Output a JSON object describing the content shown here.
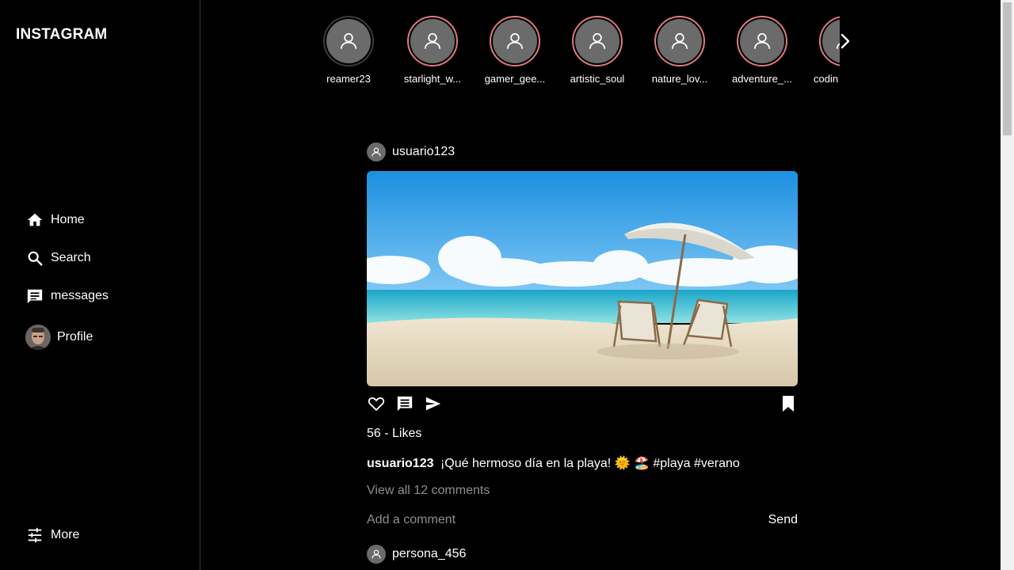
{
  "app": {
    "logo": "INSTAGRAM"
  },
  "sidebar": {
    "items": [
      {
        "label": "Home",
        "icon": "home-icon"
      },
      {
        "label": "Search",
        "icon": "search-icon"
      },
      {
        "label": "messages",
        "icon": "message-icon"
      },
      {
        "label": "Profile",
        "icon": "avatar"
      }
    ],
    "more_label": "More"
  },
  "stories": [
    {
      "name": "reamer23",
      "seen": true
    },
    {
      "name": "starlight_w...",
      "seen": false
    },
    {
      "name": "gamer_gee...",
      "seen": false
    },
    {
      "name": "artistic_soul",
      "seen": false
    },
    {
      "name": "nature_lov...",
      "seen": false
    },
    {
      "name": "adventure_...",
      "seen": false
    },
    {
      "name": "codin",
      "seen": false
    }
  ],
  "post": {
    "username": "usuario123",
    "likes": "56 - Likes",
    "caption_user": "usuario123",
    "caption_text": "¡Qué hermoso día en la playa! 🌞 🏖️ #playa #verano",
    "view_comments": "View all 12 comments",
    "comment_placeholder": "Add a comment",
    "send_label": "Send"
  },
  "next_post": {
    "username": "persona_456"
  },
  "colors": {
    "story_ring": "#e1787e",
    "background": "#000000",
    "muted_text": "#8e8e8e"
  }
}
